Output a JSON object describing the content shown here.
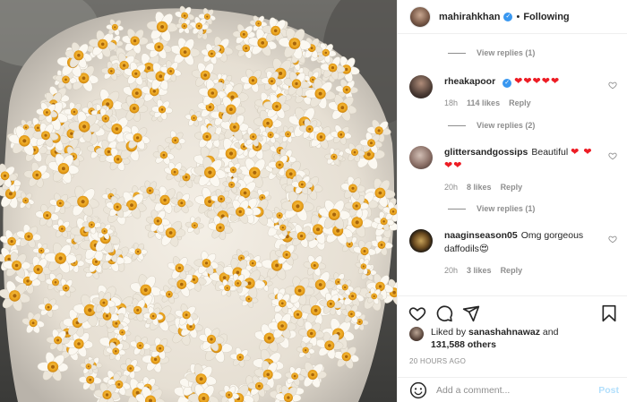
{
  "post": {
    "author": "mahirahkhan",
    "follow_status": "Following",
    "separator": "•"
  },
  "comments": [
    {
      "username": "rheakapoor",
      "verified": true,
      "text": "",
      "hearts": "❤❤❤❤❤",
      "time": "18h",
      "likes": "114 likes",
      "reply_label": "Reply"
    },
    {
      "username": "glittersandgossips",
      "verified": false,
      "text": "Beautiful",
      "hearts": "❤ ❤❤❤",
      "time": "20h",
      "likes": "8 likes",
      "reply_label": "Reply"
    },
    {
      "username": "naaginseason05",
      "verified": false,
      "text": "Omg gorgeous daffodils",
      "emoji": "😍",
      "time": "20h",
      "likes": "3 likes",
      "reply_label": "Reply"
    }
  ],
  "view_replies": [
    "View replies (1)",
    "View replies (2)",
    "View replies (1)"
  ],
  "likes_summary": {
    "prefix": "Liked by",
    "user": "sanashahnawaz",
    "conjunction": "and",
    "others": "131,588 others"
  },
  "timestamp": "20 HOURS AGO",
  "add_comment": {
    "placeholder": "Add a comment...",
    "post_label": "Post"
  },
  "icons": {
    "like": "heart-icon",
    "comment": "comment-bubble-icon",
    "share": "paper-plane-icon",
    "save": "bookmark-icon",
    "emoji": "smiley-icon",
    "comment_like": "small-heart-icon"
  },
  "colors": {
    "verified_blue": "#3897f0",
    "heart_red": "#ed1c24",
    "muted_text": "#8e8e8e",
    "post_button_disabled": "#b2dffc"
  }
}
